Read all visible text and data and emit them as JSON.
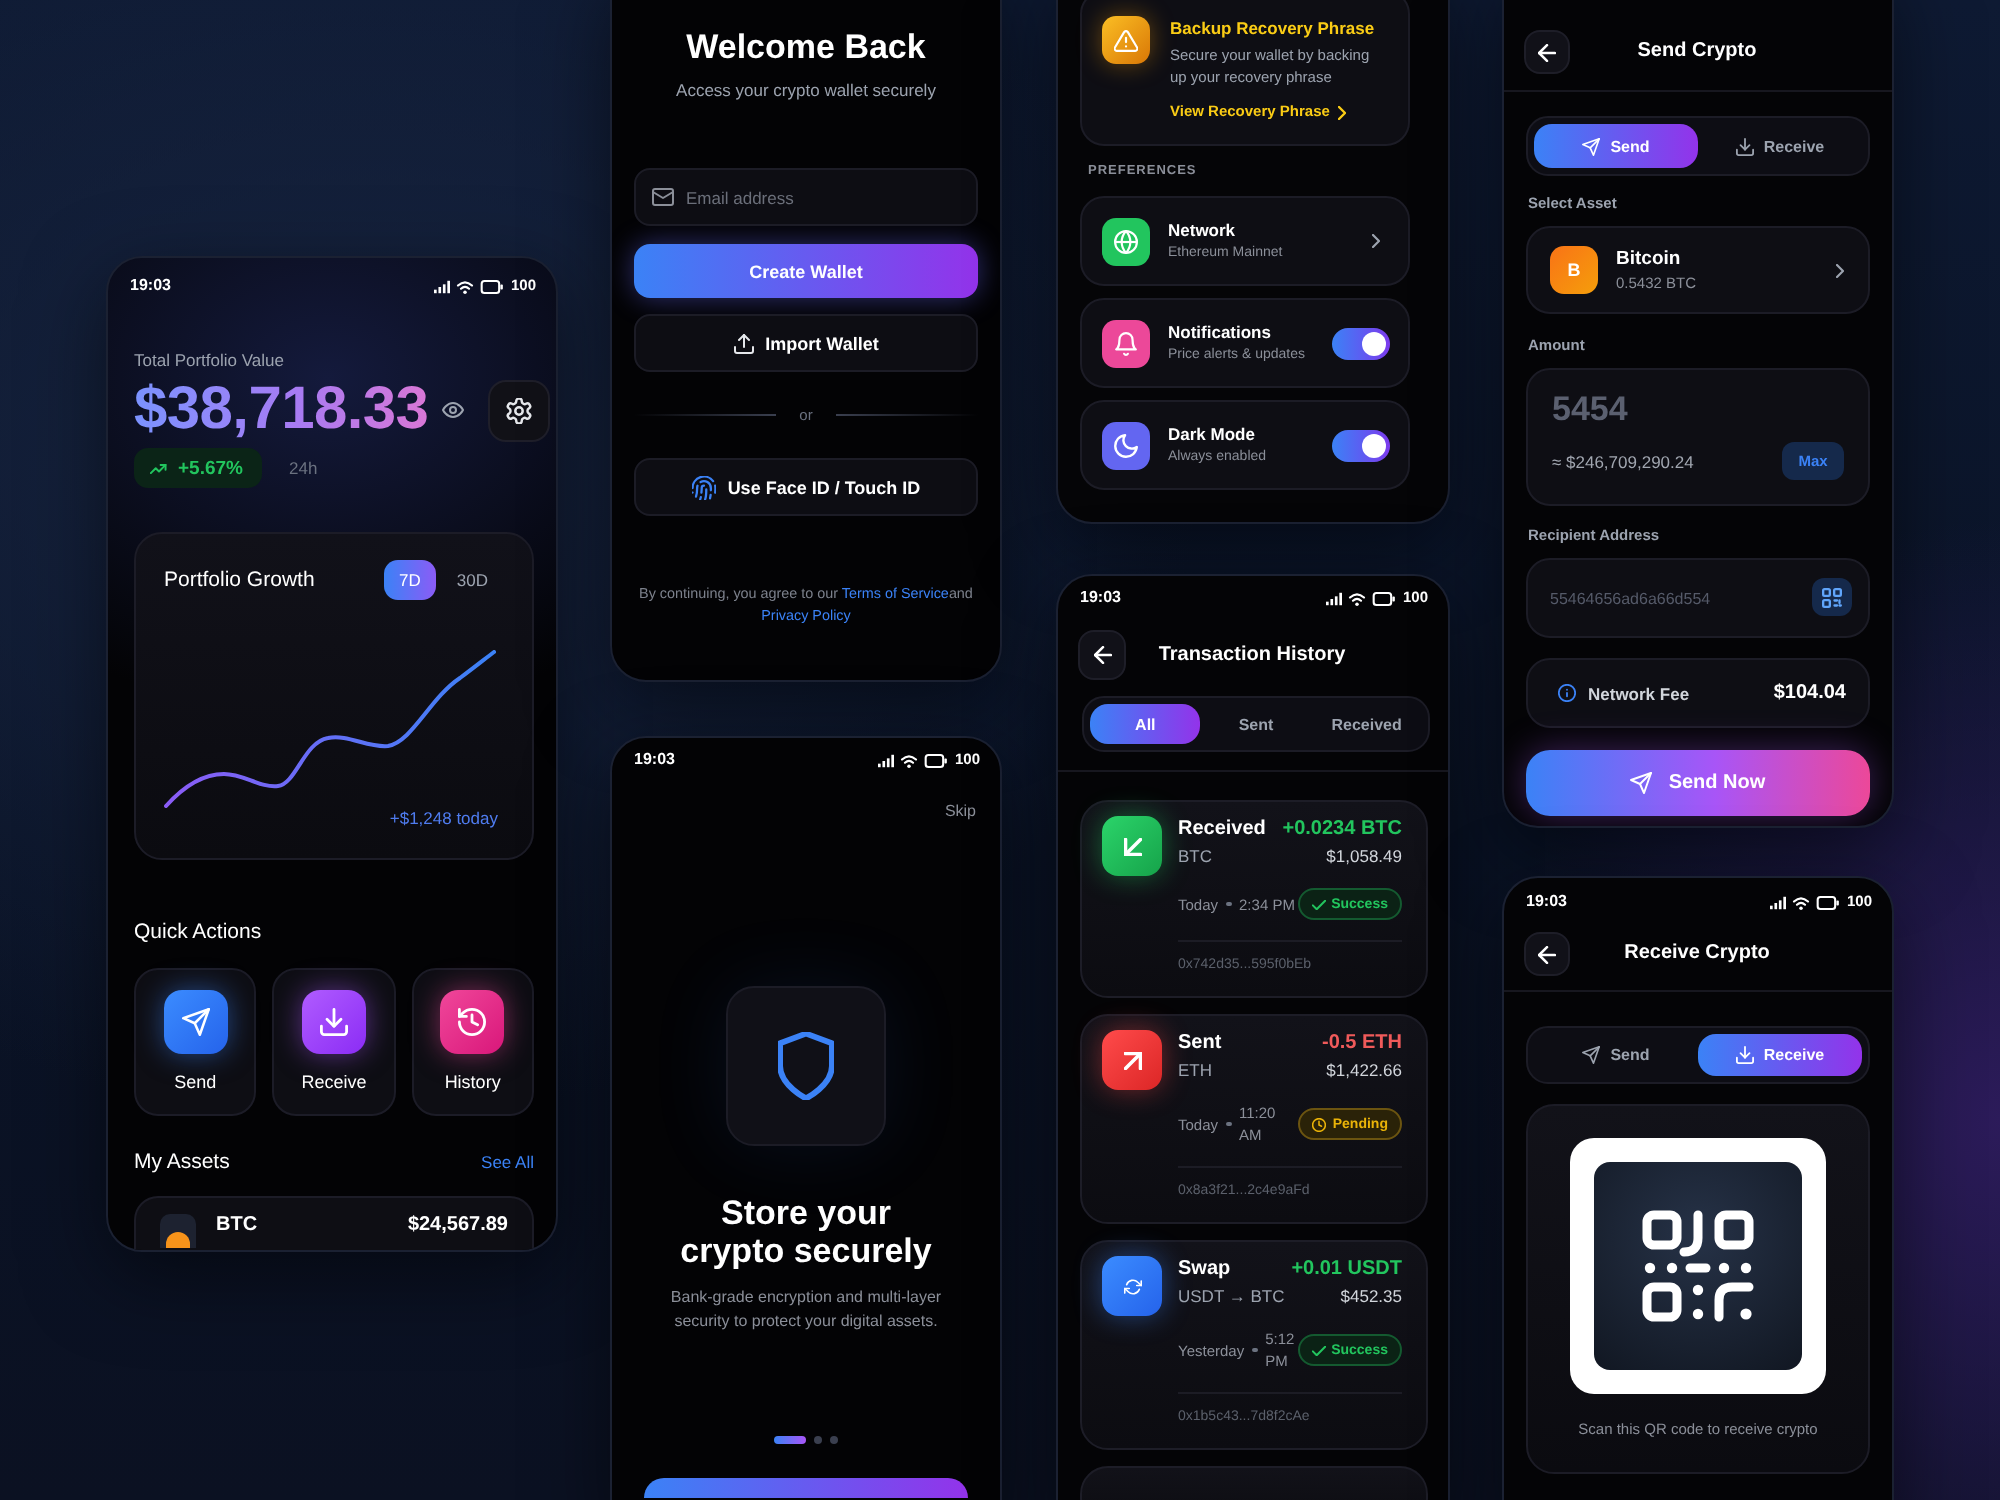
{
  "dashboard": {
    "status_bar": {
      "time": "19:03",
      "battery": "100"
    },
    "portfolio": {
      "label": "Total Portfolio Value",
      "value": "$38,718.33",
      "change": "+5.67%",
      "period": "24h"
    },
    "growth": {
      "title": "Portfolio Growth",
      "ranges": [
        {
          "label": "7D",
          "selected": true
        },
        {
          "label": "30D",
          "selected": false
        }
      ],
      "today": "+$1,248 today"
    },
    "quick_actions": {
      "title": "Quick Actions",
      "items": [
        {
          "kind": "send",
          "label": "Send"
        },
        {
          "kind": "receive",
          "label": "Receive"
        },
        {
          "kind": "history",
          "label": "History"
        }
      ]
    },
    "assets": {
      "title": "My Assets",
      "link": "See All",
      "rows": [
        {
          "symbol": "BTC",
          "value": "$24,567.89"
        }
      ]
    }
  },
  "login": {
    "title": "Welcome Back",
    "subtitle": "Access your crypto wallet securely",
    "email": {
      "placeholder": "Email address"
    },
    "create_button": "Create Wallet",
    "import_button": "Import Wallet",
    "divider": "or",
    "biometric_button": "Use Face ID / Touch ID",
    "terms": {
      "before": "By continuing, you agree to our",
      "terms_link": "Terms of Service",
      "middle": "and",
      "privacy_link": "Privacy Policy"
    }
  },
  "onboarding": {
    "status_bar": {
      "time": "19:03",
      "battery": "100"
    },
    "skip": "Skip",
    "title": "Store your crypto securely",
    "description": "Bank-grade encryption and multi-layer security to protect your digital assets.",
    "pages": [
      {
        "selected": true
      },
      {
        "selected": false
      },
      {
        "selected": false
      }
    ]
  },
  "settings": {
    "backup": {
      "title": "Backup Recovery Phrase",
      "text": "Secure your wallet by backing up your recovery phrase",
      "link": "View Recovery Phrase"
    },
    "section": "PREFERENCES",
    "rows": [
      {
        "kind": "link",
        "title": "Network",
        "subtitle": "Ethereum Mainnet",
        "color": "#22c55e"
      },
      {
        "kind": "toggle",
        "title": "Notifications",
        "subtitle": "Price alerts & updates",
        "color": "#ec4899",
        "on": true
      },
      {
        "kind": "toggle",
        "title": "Dark Mode",
        "subtitle": "Always enabled",
        "color": "#6366f1",
        "on": true
      }
    ]
  },
  "history": {
    "status_bar": {
      "time": "19:03",
      "battery": "100"
    },
    "title": "Transaction History",
    "filters": [
      {
        "label": "All",
        "selected": true
      },
      {
        "label": "Sent",
        "selected": false
      },
      {
        "label": "Received",
        "selected": false
      }
    ],
    "transactions": [
      {
        "kind": "received",
        "title": "Received",
        "asset": "BTC",
        "amount": "+0.0234 BTC",
        "value": "$1,058.49",
        "date": "Today",
        "time": "2:34 PM",
        "status": {
          "kind": "success",
          "label": "Success"
        },
        "hash": "0x742d35...595f0bEb"
      },
      {
        "kind": "sent",
        "title": "Sent",
        "asset": "ETH",
        "amount": "-0.5 ETH",
        "value": "$1,422.66",
        "date": "Today",
        "time": "11:20 AM",
        "status": {
          "kind": "pending",
          "label": "Pending"
        },
        "hash": "0x8a3f21...2c4e9aFd"
      },
      {
        "kind": "swap",
        "title": "Swap",
        "asset": "USDT → BTC",
        "amount": "+0.01 USDT",
        "value": "$452.35",
        "date": "Yesterday",
        "time": "5:12 PM",
        "status": {
          "kind": "success",
          "label": "Success"
        },
        "hash": "0x1b5c43...7d8f2cAe"
      }
    ]
  },
  "send": {
    "title": "Send Crypto",
    "tabs": [
      {
        "label": "Send",
        "selected": true
      },
      {
        "label": "Receive",
        "selected": false
      }
    ],
    "asset_label": "Select Asset",
    "asset": {
      "logo": "B",
      "name": "Bitcoin",
      "balance": "0.5432 BTC"
    },
    "amount_label": "Amount",
    "amount": "5454",
    "fiat": "≈ $246,709,290.24",
    "max_button": "Max",
    "recipient_label": "Recipient Address",
    "recipient": {
      "value": "55464656ad6a66d554"
    },
    "fee_label": "Network Fee",
    "fee": "$104.04",
    "submit_button": "Send Now"
  },
  "receive": {
    "status_bar": {
      "time": "19:03",
      "battery": "100"
    },
    "title": "Receive Crypto",
    "tabs": [
      {
        "label": "Send",
        "selected": false
      },
      {
        "label": "Receive",
        "selected": true
      }
    ],
    "caption": "Scan this QR code to receive crypto"
  }
}
